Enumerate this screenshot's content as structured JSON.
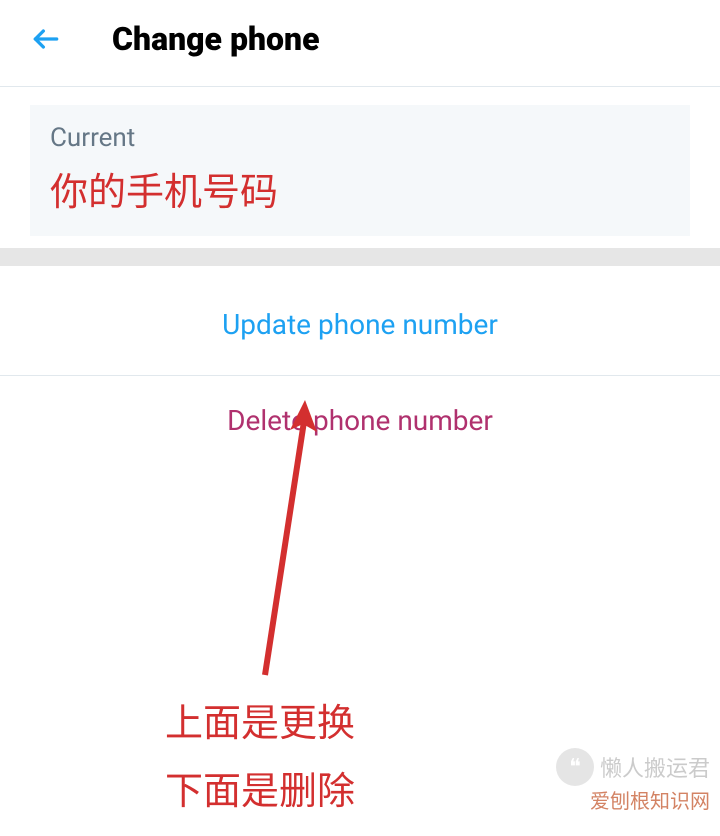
{
  "header": {
    "title": "Change phone"
  },
  "current_field": {
    "label": "Current",
    "annotation": "你的手机号码"
  },
  "actions": {
    "update_label": "Update phone number",
    "delete_label": "Delete phone number"
  },
  "explanation": {
    "line1": "上面是更换",
    "line2": "下面是删除"
  },
  "watermarks": {
    "wm1": "懒人搬运君",
    "wm2": "爱刨根知识网"
  }
}
